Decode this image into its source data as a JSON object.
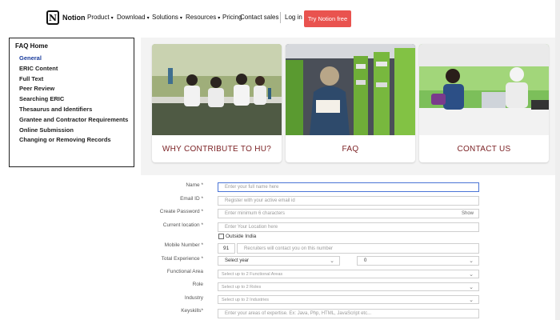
{
  "nav": {
    "logo_text": "Notion",
    "logo_glyph": "N",
    "items": [
      {
        "label": "Product",
        "chevron": true
      },
      {
        "label": "Download",
        "chevron": true
      },
      {
        "label": "Solutions",
        "chevron": true
      },
      {
        "label": "Resources",
        "chevron": true
      },
      {
        "label": "Pricing",
        "chevron": false
      }
    ],
    "contact_sales": "Contact sales",
    "login": "Log in",
    "try_free": "Try Notion free",
    "accent": "#e9534f"
  },
  "faq": {
    "title": "FAQ Home",
    "items": [
      {
        "label": "General",
        "active": true
      },
      {
        "label": "ERIC Content"
      },
      {
        "label": "Full Text"
      },
      {
        "label": "Peer Review"
      },
      {
        "label": "Searching ERIC"
      },
      {
        "label": "Thesaurus and Identifiers"
      },
      {
        "label": "Grantee and Contractor Requirements"
      },
      {
        "label": "Online Submission"
      },
      {
        "label": "Changing or Removing Records"
      }
    ]
  },
  "cards": [
    {
      "label": "WHY CONTRIBUTE TO HU?"
    },
    {
      "label": "FAQ"
    },
    {
      "label": "CONTACT US"
    }
  ],
  "form": {
    "name_label": "Name *",
    "name_placeholder": "Enter your full name here",
    "email_label": "Email ID *",
    "email_placeholder": "Register with your active email id",
    "password_label": "Create Password *",
    "password_placeholder": "Enter minimum 6 characters",
    "password_show": "Show",
    "location_label": "Current location *",
    "location_placeholder": "Enter Your Location here",
    "outside_india": "Outside India",
    "mobile_label": "Mobile Number *",
    "mobile_code": "91",
    "mobile_placeholder": "Recruiters will contact you on this number",
    "experience_label": "Total Experience *",
    "experience_years": "Select year",
    "experience_months": "0",
    "functional_label": "Functional Area",
    "functional_placeholder": "Select up to 2 Functional Areas",
    "role_label": "Role",
    "role_placeholder": "Select up to 2 Roles",
    "industry_label": "Industry",
    "industry_placeholder": "Select up to 2 Industries",
    "keyskills_label": "Keyskills*",
    "keyskills_placeholder": "Enter your areas of expertise. Ex: Java, Php, HTML, JavaScript etc..."
  }
}
